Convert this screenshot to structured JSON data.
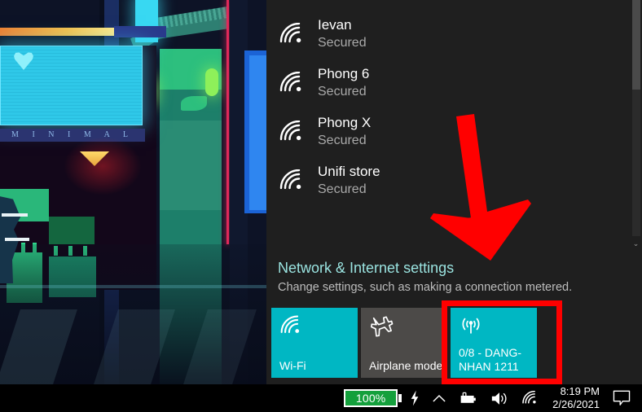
{
  "wallpaper": {
    "banner_text": "M I N I M A L"
  },
  "flyout": {
    "networks": [
      {
        "name": "Ievan",
        "status": "Secured",
        "icon": "wifi-icon",
        "bars": 3
      },
      {
        "name": "Phong 6",
        "status": "Secured",
        "icon": "wifi-icon",
        "bars": 3
      },
      {
        "name": "Phong X",
        "status": "Secured",
        "icon": "wifi-icon",
        "bars": 3
      },
      {
        "name": "Unifi store",
        "status": "Secured",
        "icon": "wifi-icon",
        "bars": 3
      }
    ],
    "settings_link": "Network & Internet settings",
    "settings_sub": "Change settings, such as making a connection metered.",
    "tiles": [
      {
        "label": "Wi-Fi",
        "icon": "wifi-icon",
        "state": "on"
      },
      {
        "label": "Airplane mode",
        "icon": "airplane-icon",
        "state": "off"
      },
      {
        "label": "0/8 - DANG-NHAN 1211",
        "icon": "mobile-hotspot-icon",
        "state": "on"
      }
    ],
    "scrollbar": {
      "down_chevron": "⌄"
    }
  },
  "annotations": {
    "arrow": {
      "color": "#ff0000",
      "points_to": "mobile-hotspot-tile"
    },
    "highlight_box": {
      "color": "#ff0000",
      "target": "mobile-hotspot-tile"
    }
  },
  "taskbar": {
    "battery_percent": "100%",
    "icons": [
      "lightning-bolt-icon",
      "chevron-up-icon",
      "battery-charging-icon",
      "speaker-icon",
      "wifi-icon"
    ],
    "clock_time": "8:19 PM",
    "clock_date": "2/26/2021",
    "action_center_icon": "speech-bubble-icon"
  },
  "colors": {
    "flyout_bg": "#1f1f1f",
    "tile_on": "#00b7c3",
    "tile_off": "#4c4a48",
    "link": "#9ae3e0",
    "annotation_red": "#ff0000",
    "battery_green": "#14a03c"
  }
}
